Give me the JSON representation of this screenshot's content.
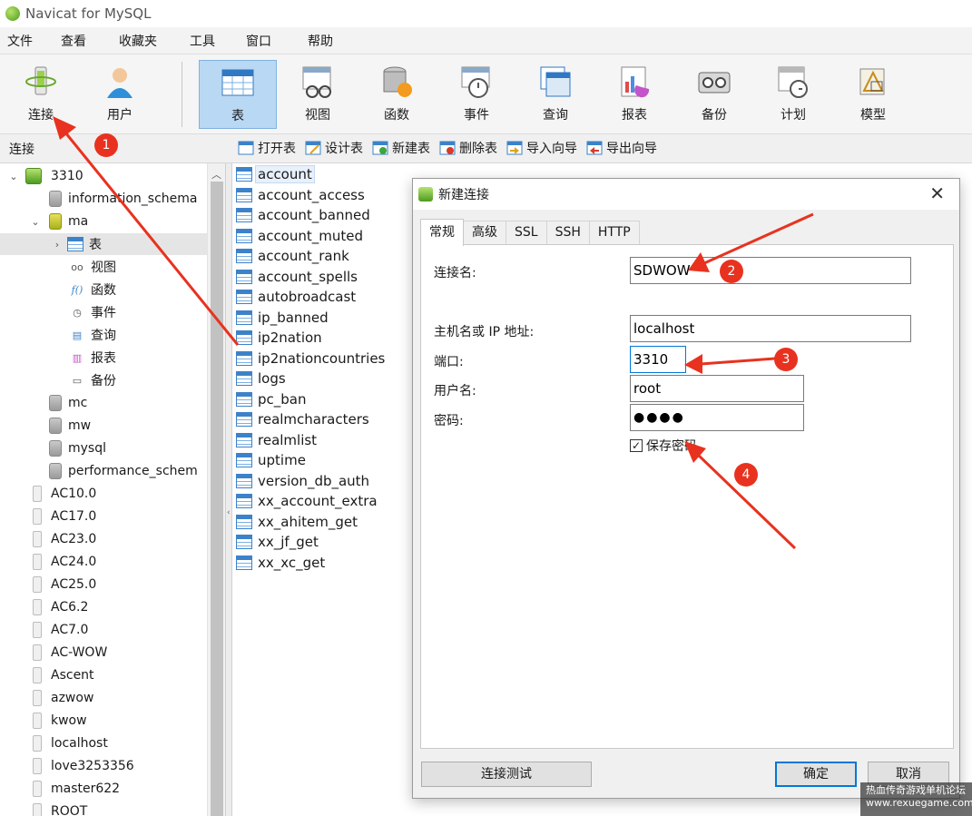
{
  "window": {
    "title": "Navicat for MySQL"
  },
  "menubar": {
    "items": [
      "文件",
      "查看",
      "收藏夹",
      "工具",
      "窗口",
      "帮助"
    ]
  },
  "toolbar": {
    "buttons": [
      {
        "label": "连接",
        "icon": "connection-icon"
      },
      {
        "label": "用户",
        "icon": "user-icon"
      },
      {
        "label": "表",
        "icon": "table-icon",
        "active": true
      },
      {
        "label": "视图",
        "icon": "view-icon"
      },
      {
        "label": "函数",
        "icon": "function-icon"
      },
      {
        "label": "事件",
        "icon": "event-icon"
      },
      {
        "label": "查询",
        "icon": "query-icon"
      },
      {
        "label": "报表",
        "icon": "report-icon"
      },
      {
        "label": "备份",
        "icon": "backup-icon"
      },
      {
        "label": "计划",
        "icon": "schedule-icon"
      },
      {
        "label": "模型",
        "icon": "model-icon"
      }
    ]
  },
  "objbar": {
    "connection_label": "连接",
    "actions": [
      "打开表",
      "设计表",
      "新建表",
      "删除表",
      "导入向导",
      "导出向导"
    ]
  },
  "tree": {
    "items": [
      {
        "label": "3310",
        "kind": "connection-open"
      },
      {
        "label": "information_schema",
        "kind": "db"
      },
      {
        "label": "ma",
        "kind": "db-open"
      },
      {
        "label": "表",
        "kind": "tables-node"
      },
      {
        "label": "视图",
        "kind": "views-node"
      },
      {
        "label": "函数",
        "kind": "functions-node"
      },
      {
        "label": "事件",
        "kind": "events-node"
      },
      {
        "label": "查询",
        "kind": "queries-node"
      },
      {
        "label": "报表",
        "kind": "reports-node"
      },
      {
        "label": "备份",
        "kind": "backups-node"
      },
      {
        "label": "mc",
        "kind": "db"
      },
      {
        "label": "mw",
        "kind": "db"
      },
      {
        "label": "mysql",
        "kind": "db"
      },
      {
        "label": "performance_schem",
        "kind": "db"
      },
      {
        "label": "AC10.0",
        "kind": "connection"
      },
      {
        "label": "AC17.0",
        "kind": "connection"
      },
      {
        "label": "AC23.0",
        "kind": "connection"
      },
      {
        "label": "AC24.0",
        "kind": "connection"
      },
      {
        "label": "AC25.0",
        "kind": "connection"
      },
      {
        "label": "AC6.2",
        "kind": "connection"
      },
      {
        "label": "AC7.0",
        "kind": "connection"
      },
      {
        "label": "AC-WOW",
        "kind": "connection"
      },
      {
        "label": "Ascent",
        "kind": "connection"
      },
      {
        "label": "azwow",
        "kind": "connection"
      },
      {
        "label": "kwow",
        "kind": "connection"
      },
      {
        "label": "localhost",
        "kind": "connection"
      },
      {
        "label": "love3253356",
        "kind": "connection"
      },
      {
        "label": "master622",
        "kind": "connection"
      },
      {
        "label": "ROOT",
        "kind": "connection"
      }
    ]
  },
  "tables": [
    "account",
    "account_access",
    "account_banned",
    "account_muted",
    "account_rank",
    "account_spells",
    "autobroadcast",
    "ip_banned",
    "ip2nation",
    "ip2nationcountries",
    "logs",
    "pc_ban",
    "realmcharacters",
    "realmlist",
    "uptime",
    "version_db_auth",
    "xx_account_extra",
    "xx_ahitem_get",
    "xx_jf_get",
    "xx_xc_get"
  ],
  "dialog": {
    "title": "新建连接",
    "tabs": [
      "常规",
      "高级",
      "SSL",
      "SSH",
      "HTTP"
    ],
    "fields": {
      "connection_name": {
        "label": "连接名:",
        "value": "SDWOW"
      },
      "host": {
        "label": "主机名或 IP 地址:",
        "value": "localhost"
      },
      "port": {
        "label": "端口:",
        "value": "3310"
      },
      "username": {
        "label": "用户名:",
        "value": "root"
      },
      "password": {
        "label": "密码:",
        "value": "●●●●"
      }
    },
    "save_password": {
      "label": "保存密码",
      "checked": true
    },
    "buttons": {
      "test": "连接测试",
      "ok": "确定",
      "cancel": "取消"
    }
  },
  "annotations": {
    "badges": [
      "1",
      "2",
      "3",
      "4"
    ],
    "color": "#e8321f"
  },
  "watermark": {
    "line1": "热血传奇游戏单机论坛",
    "line2": "www.rexuegame.com"
  }
}
